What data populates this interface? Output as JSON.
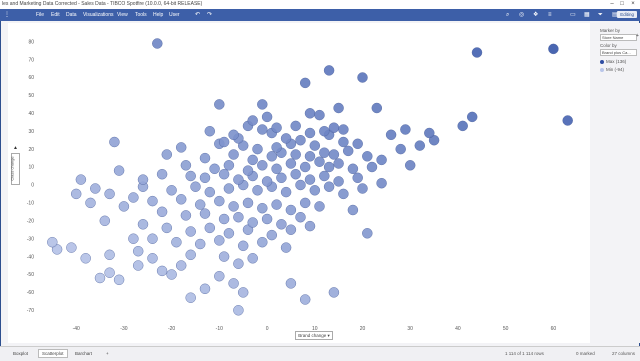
{
  "window": {
    "title": "les and Marketing Data Corrected - Sales Data - TIBCO Spotfire (10.0.0, 64-bit RELEASE)"
  },
  "menu": {
    "items": [
      "File",
      "Edit",
      "Data",
      "Visualizations",
      "View",
      "Tools",
      "Help",
      "User"
    ],
    "editing_label": "Editing"
  },
  "right_panel": {
    "marker_by_label": "Marker by",
    "marker_by_value": "Store Name",
    "color_by_label": "Color by",
    "color_by_value": "Brand plus Ca...",
    "legend": [
      {
        "label": "Max (136)",
        "color": "#2f4ea3"
      },
      {
        "label": "Min (-94)",
        "color": "#b9c6ea"
      }
    ]
  },
  "axes": {
    "x_selector": "Brand change",
    "y_selector": "Class change"
  },
  "tabs": [
    "Boxplot",
    "Scatterplot",
    "Barchart"
  ],
  "active_tab": "Scatterplot",
  "status": {
    "rows": "1 114 of 1 114 rows",
    "marked": "0 marked",
    "columns": "27 columns"
  },
  "chart_data": {
    "type": "scatter",
    "xlabel": "Brand change",
    "ylabel": "Class change",
    "xlim": [
      -48,
      66
    ],
    "ylim": [
      -76,
      86
    ],
    "x_ticks": [
      -40,
      -30,
      -20,
      -10,
      0,
      10,
      20,
      30,
      40,
      50,
      60
    ],
    "y_ticks": [
      80,
      70,
      60,
      50,
      40,
      30,
      20,
      10,
      0,
      -10,
      -20,
      -30,
      -40,
      -50,
      -60,
      -70
    ],
    "grid": false,
    "series": [
      {
        "points": [
          [
            -23,
            79
          ],
          [
            60,
            76
          ],
          [
            44,
            74
          ],
          [
            13,
            64
          ],
          [
            20,
            60
          ],
          [
            8,
            57
          ],
          [
            -10,
            45
          ],
          [
            -1,
            45
          ],
          [
            15,
            43
          ],
          [
            23,
            43
          ],
          [
            9,
            40
          ],
          [
            0,
            38
          ],
          [
            11,
            39
          ],
          [
            -3,
            36
          ],
          [
            -4,
            33
          ],
          [
            2,
            32
          ],
          [
            -1,
            31
          ],
          [
            14,
            32
          ],
          [
            6,
            33
          ],
          [
            16,
            31
          ],
          [
            -12,
            30
          ],
          [
            -7,
            28
          ],
          [
            1,
            29
          ],
          [
            9,
            29
          ],
          [
            12,
            30
          ],
          [
            -6,
            26
          ],
          [
            4,
            26
          ],
          [
            7,
            25
          ],
          [
            13,
            28
          ],
          [
            -9,
            24
          ],
          [
            -18,
            21
          ],
          [
            -10,
            23
          ],
          [
            -5,
            22
          ],
          [
            -2,
            20
          ],
          [
            2,
            21
          ],
          [
            5,
            23
          ],
          [
            10,
            22
          ],
          [
            16,
            24
          ],
          [
            19,
            23
          ],
          [
            26,
            28
          ],
          [
            29,
            31
          ],
          [
            34,
            29
          ],
          [
            35,
            25
          ],
          [
            41,
            33
          ],
          [
            43,
            38
          ],
          [
            63,
            36
          ],
          [
            -21,
            17
          ],
          [
            -13,
            15
          ],
          [
            -7,
            17
          ],
          [
            -3,
            14
          ],
          [
            1,
            16
          ],
          [
            3,
            18
          ],
          [
            6,
            17
          ],
          [
            9,
            16
          ],
          [
            12,
            18
          ],
          [
            14,
            17
          ],
          [
            17,
            19
          ],
          [
            21,
            16
          ],
          [
            24,
            14
          ],
          [
            28,
            20
          ],
          [
            32,
            22
          ],
          [
            -32,
            24
          ],
          [
            -17,
            11
          ],
          [
            -11,
            9
          ],
          [
            -8,
            11
          ],
          [
            -4,
            8
          ],
          [
            -1,
            11
          ],
          [
            2,
            9
          ],
          [
            5,
            12
          ],
          [
            8,
            10
          ],
          [
            11,
            13
          ],
          [
            13,
            10
          ],
          [
            15,
            12
          ],
          [
            18,
            9
          ],
          [
            22,
            10
          ],
          [
            30,
            11
          ],
          [
            -31,
            8
          ],
          [
            -26,
            3
          ],
          [
            -22,
            6
          ],
          [
            -16,
            5
          ],
          [
            -13,
            4
          ],
          [
            -9,
            6
          ],
          [
            -6,
            3
          ],
          [
            -3,
            5
          ],
          [
            0,
            2
          ],
          [
            3,
            4
          ],
          [
            6,
            6
          ],
          [
            9,
            3
          ],
          [
            12,
            5
          ],
          [
            15,
            2
          ],
          [
            19,
            4
          ],
          [
            24,
            1
          ],
          [
            -39,
            3
          ],
          [
            -36,
            -2
          ],
          [
            -33,
            -5
          ],
          [
            -26,
            -1
          ],
          [
            -20,
            -3
          ],
          [
            -15,
            -1
          ],
          [
            -12,
            -4
          ],
          [
            -8,
            -2
          ],
          [
            -5,
            0
          ],
          [
            -2,
            -3
          ],
          [
            1,
            -1
          ],
          [
            4,
            -4
          ],
          [
            7,
            0
          ],
          [
            10,
            -3
          ],
          [
            13,
            -1
          ],
          [
            16,
            -5
          ],
          [
            20,
            -2
          ],
          [
            -28,
            -7
          ],
          [
            -24,
            -9
          ],
          [
            -18,
            -8
          ],
          [
            -14,
            -11
          ],
          [
            -10,
            -9
          ],
          [
            -7,
            -12
          ],
          [
            -4,
            -10
          ],
          [
            -1,
            -13
          ],
          [
            2,
            -11
          ],
          [
            5,
            -14
          ],
          [
            8,
            -10
          ],
          [
            11,
            -12
          ],
          [
            -37,
            -10
          ],
          [
            -30,
            -12
          ],
          [
            -22,
            -15
          ],
          [
            -17,
            -17
          ],
          [
            -13,
            -16
          ],
          [
            -9,
            -19
          ],
          [
            -6,
            -18
          ],
          [
            -3,
            -21
          ],
          [
            0,
            -19
          ],
          [
            3,
            -22
          ],
          [
            7,
            -18
          ],
          [
            -34,
            -20
          ],
          [
            -26,
            -22
          ],
          [
            -21,
            -24
          ],
          [
            -16,
            -26
          ],
          [
            -12,
            -24
          ],
          [
            -8,
            -27
          ],
          [
            -4,
            -25
          ],
          [
            1,
            -28
          ],
          [
            5,
            -25
          ],
          [
            9,
            -23
          ],
          [
            21,
            -27
          ],
          [
            -24,
            -30
          ],
          [
            -19,
            -32
          ],
          [
            -14,
            -33
          ],
          [
            -10,
            -31
          ],
          [
            -5,
            -34
          ],
          [
            -1,
            -32
          ],
          [
            4,
            -35
          ],
          [
            -41,
            -35
          ],
          [
            -27,
            -37
          ],
          [
            -33,
            -39
          ],
          [
            -24,
            -41
          ],
          [
            -16,
            -39
          ],
          [
            -9,
            -40
          ],
          [
            -6,
            -44
          ],
          [
            -3,
            -41
          ],
          [
            -38,
            -41
          ],
          [
            -44,
            -36
          ],
          [
            -27,
            -45
          ],
          [
            -33,
            -49
          ],
          [
            -35,
            -52
          ],
          [
            -31,
            -53
          ],
          [
            -20,
            -50
          ],
          [
            -22,
            -48
          ],
          [
            -10,
            -51
          ],
          [
            -7,
            -55
          ],
          [
            -13,
            -58
          ],
          [
            -5,
            -60
          ],
          [
            -16,
            -63
          ],
          [
            5,
            -55
          ],
          [
            8,
            -64
          ],
          [
            14,
            -60
          ],
          [
            -6,
            -70
          ],
          [
            -18,
            -45
          ],
          [
            -28,
            -30
          ],
          [
            18,
            -14
          ],
          [
            -40,
            -5
          ],
          [
            -45,
            -32
          ]
        ]
      }
    ]
  }
}
